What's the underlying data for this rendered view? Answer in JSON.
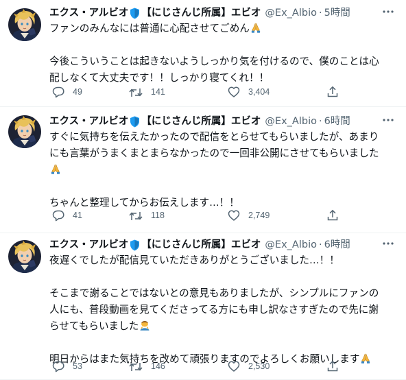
{
  "tweets": [
    {
      "display_name": "エクス・アルビオ",
      "affiliation": "【にじさんじ所属】エビオ",
      "handle": "@Ex_Albio",
      "dot": "·",
      "time": "5時間",
      "lines": [
        "ファンのみんなには普通に心配させてごめん",
        "",
        "今後こういうことは起きないようしっかり気を付けるので、僕のことは心",
        "配しなくて大丈夫です！！しっかり寝てくれ！！"
      ],
      "reply_count": "49",
      "retweet_count": "141",
      "like_count": "3,404"
    },
    {
      "display_name": "エクス・アルビオ",
      "affiliation": "【にじさんじ所属】エビオ",
      "handle": "@Ex_Albio",
      "dot": "·",
      "time": "6時間",
      "lines": [
        "すぐに気持ちを伝えたかったので配信をとらせてもらいましたが、あまり",
        "にも言葉がうまくまとまらなかったので一回非公開にさせてもらいました",
        "",
        "",
        "ちゃんと整理してからお伝えします…！！"
      ],
      "reply_count": "41",
      "retweet_count": "118",
      "like_count": "2,749"
    },
    {
      "display_name": "エクス・アルビオ",
      "affiliation": "【にじさんじ所属】エビオ",
      "handle": "@Ex_Albio",
      "dot": "·",
      "time": "6時間",
      "lines": [
        "夜遅くでしたが配信見ていただきありがとうございました…！！",
        "",
        "そこまで謝ることではないとの意見もありましたが、シンプルにファンの",
        "人にも、普段動画を見てくださってる方にも申し訳なさすぎたので先に謝",
        "らせてもらいました",
        "",
        "明日からはまた気持ちを改めて頑張りますのでよろしくお願いします"
      ],
      "reply_count": "53",
      "retweet_count": "146",
      "like_count": "2,530"
    }
  ],
  "icons": {
    "verified": "verified-shield-icon",
    "more": "more-options-icon",
    "reply": "reply-icon",
    "retweet": "retweet-icon",
    "like": "like-heart-icon",
    "share": "share-icon",
    "pray_emoji": "folded-hands-emoji",
    "bow_emoji": "bowing-person-emoji"
  },
  "colors": {
    "text": "#0f1419",
    "secondary": "#536471",
    "verified": "#1d9bf0",
    "divider": "#eff3f4"
  }
}
